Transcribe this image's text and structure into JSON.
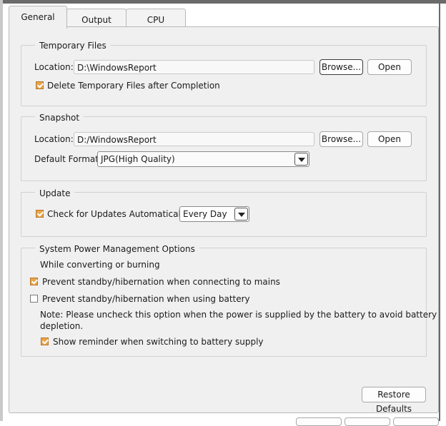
{
  "tabs": [
    {
      "label": "General",
      "active": true
    },
    {
      "label": "Output",
      "active": false
    },
    {
      "label": "CPU",
      "active": false
    }
  ],
  "temp_files": {
    "legend": "Temporary Files",
    "location_label": "Location:",
    "location_value": "D:\\WindowsReport",
    "browse_label": "Browse...",
    "open_label": "Open",
    "delete_label": "Delete Temporary Files after Completion",
    "delete_checked": true
  },
  "snapshot": {
    "legend": "Snapshot",
    "location_label": "Location:",
    "location_value": "D:/WindowsReport",
    "browse_label": "Browse...",
    "open_label": "Open",
    "format_label": "Default Format:",
    "format_value": "JPG(High Quality)"
  },
  "update": {
    "legend": "Update",
    "check_label": "Check for Updates Automatically:",
    "check_checked": true,
    "frequency_value": "Every Day"
  },
  "power": {
    "legend": "System Power Management Options",
    "subheading": "While converting or burning",
    "mains_label": "Prevent standby/hibernation when connecting to mains",
    "mains_checked": true,
    "battery_label": "Prevent standby/hibernation when using battery",
    "battery_checked": false,
    "note_line1": "Note: Please uncheck this option when the power is supplied by the battery to avoid battery",
    "note_line2": "depletion.",
    "reminder_label": "Show reminder when switching to battery supply",
    "reminder_checked": true
  },
  "restore_label": "Restore Defaults",
  "colors": {
    "accent_check": "#e8a54a",
    "panel_bg": "#f0f0f0"
  }
}
